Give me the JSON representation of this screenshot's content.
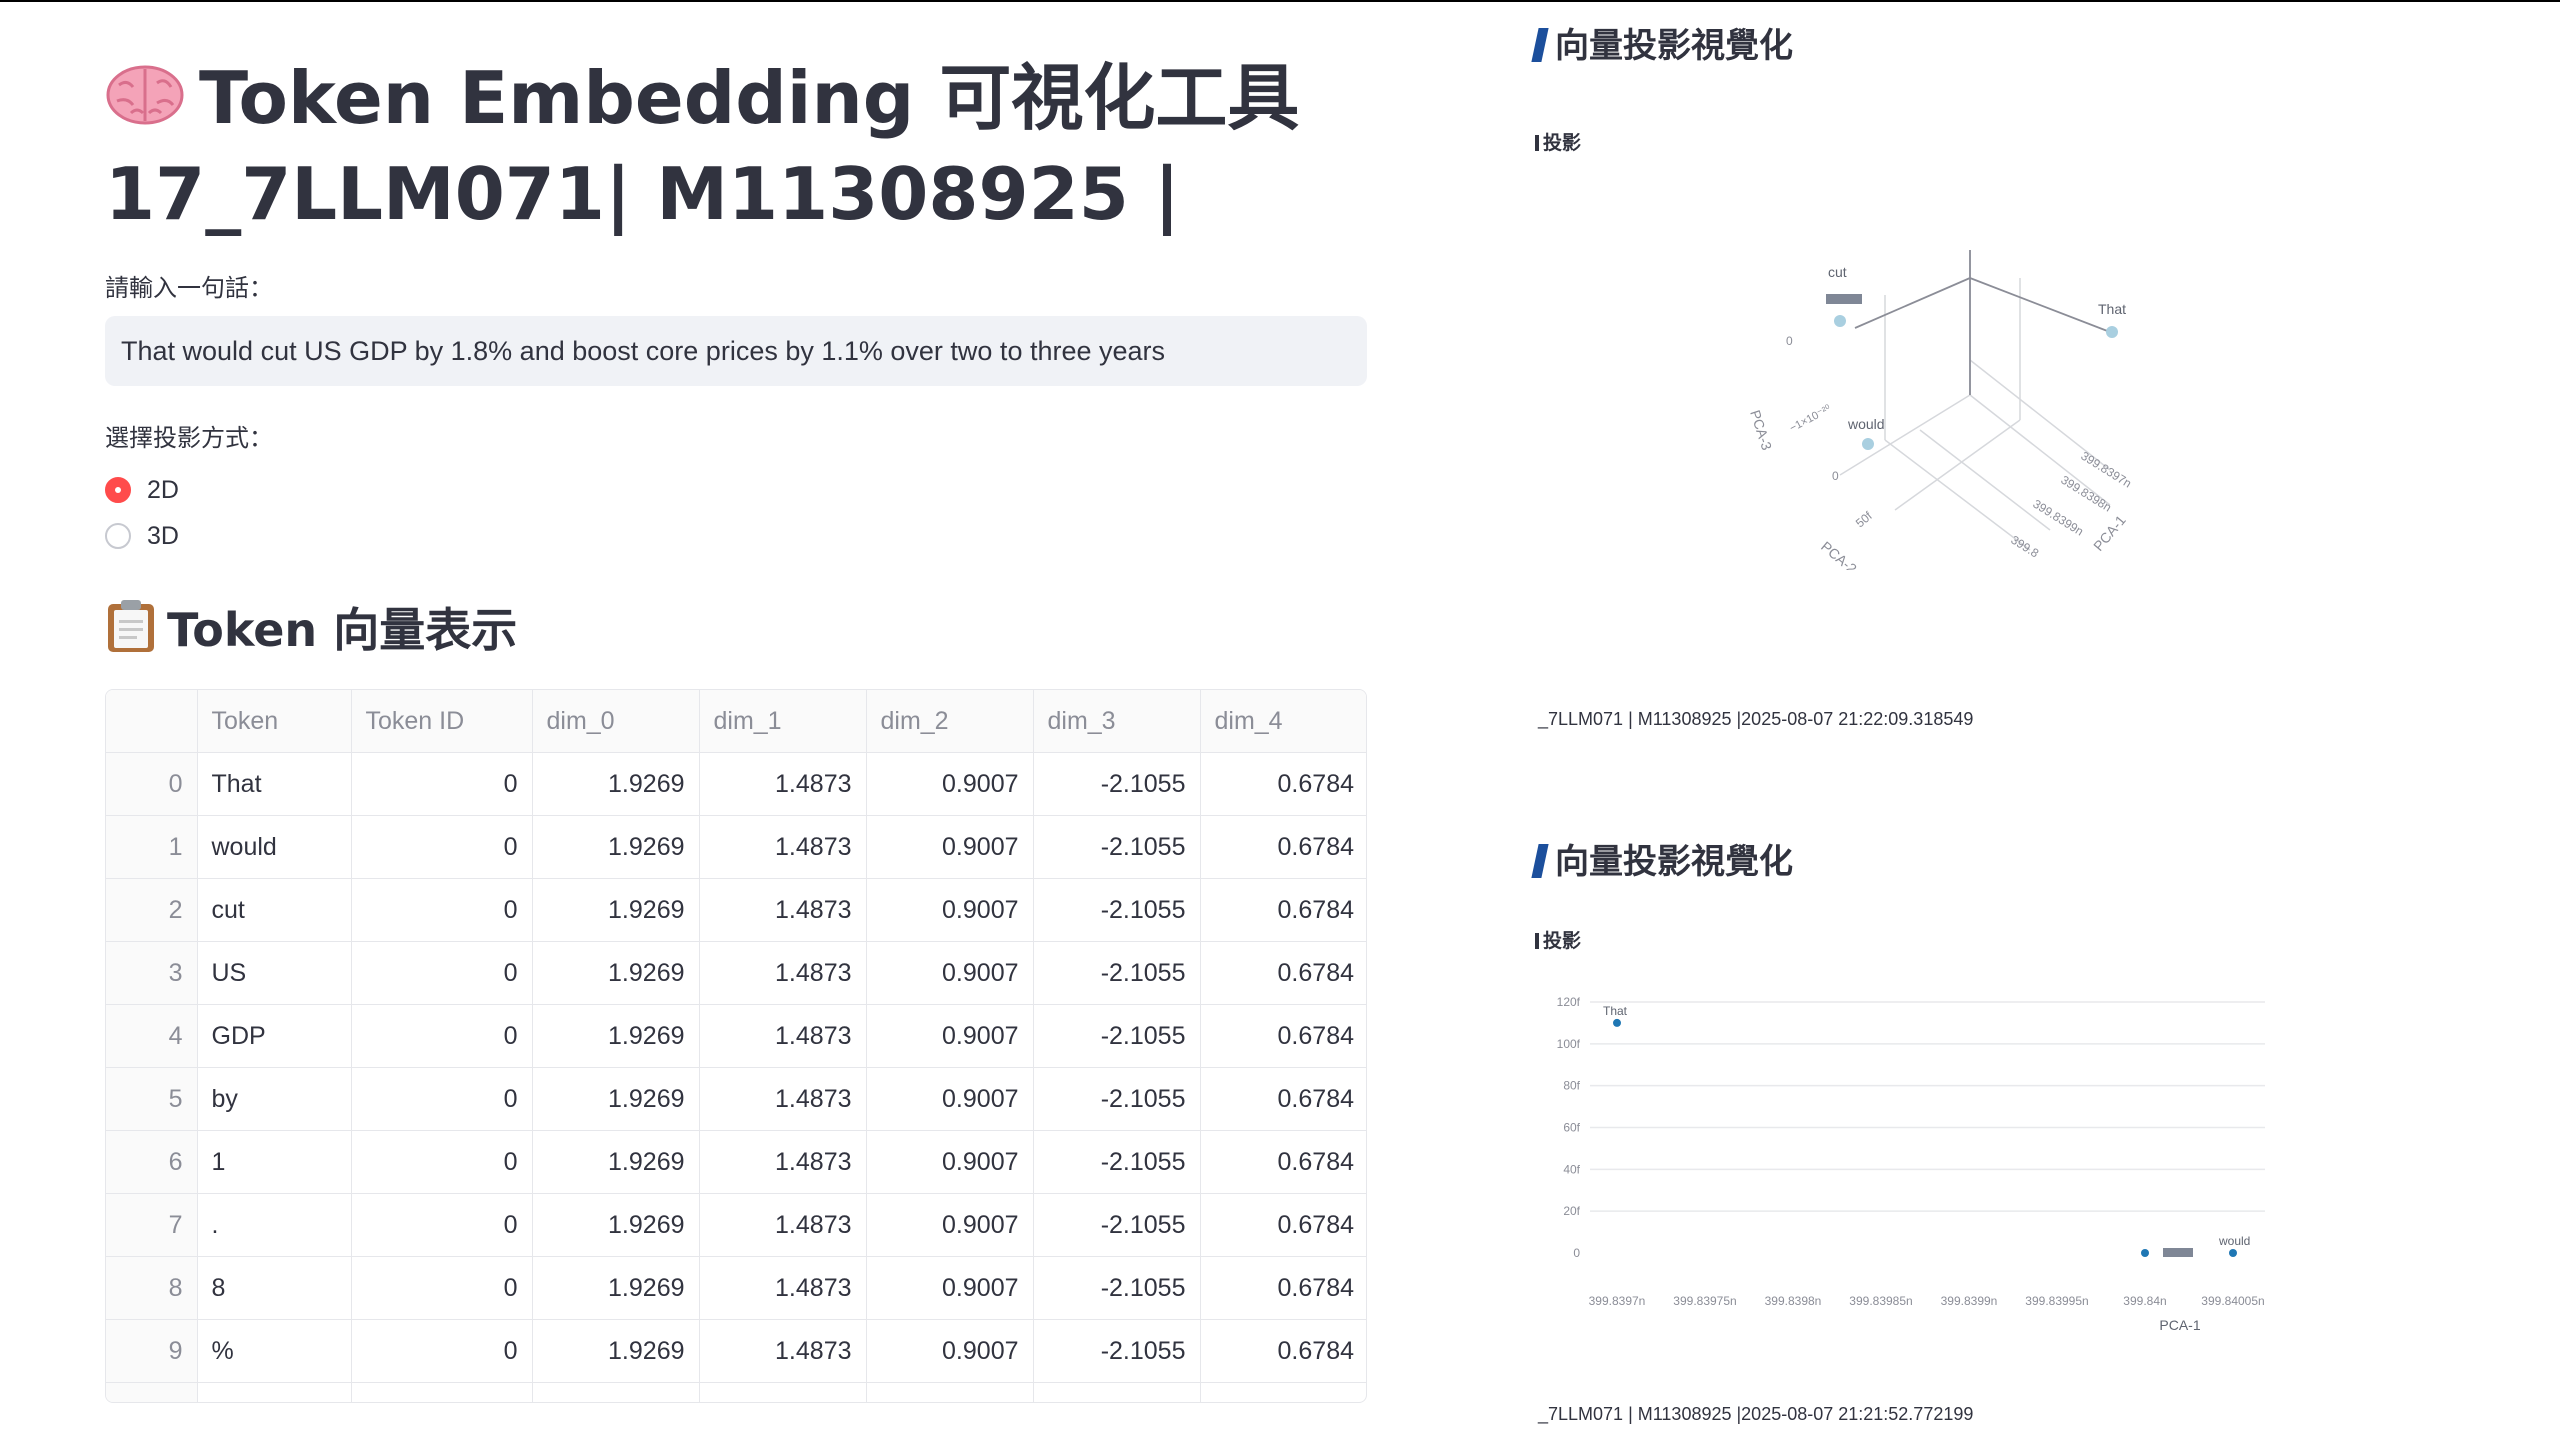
{
  "header": {
    "title_line1": "Token Embedding 可視化工具",
    "title_line2": "17_7LLM071| M11308925 |"
  },
  "input": {
    "label": "請輸入一句話：",
    "value": "That would cut US GDP by 1.8% and boost core prices by 1.1% over two to three years"
  },
  "projection": {
    "label": "選擇投影方式：",
    "options": [
      "2D",
      "3D"
    ],
    "selected": "2D"
  },
  "table_section": {
    "title": "Token 向量表示",
    "columns": [
      "",
      "Token",
      "Token ID",
      "dim_0",
      "dim_1",
      "dim_2",
      "dim_3",
      "dim_4"
    ],
    "rows": [
      [
        "0",
        "That",
        "0",
        "1.9269",
        "1.4873",
        "0.9007",
        "-2.1055",
        "0.6784"
      ],
      [
        "1",
        "would",
        "0",
        "1.9269",
        "1.4873",
        "0.9007",
        "-2.1055",
        "0.6784"
      ],
      [
        "2",
        "cut",
        "0",
        "1.9269",
        "1.4873",
        "0.9007",
        "-2.1055",
        "0.6784"
      ],
      [
        "3",
        "US",
        "0",
        "1.9269",
        "1.4873",
        "0.9007",
        "-2.1055",
        "0.6784"
      ],
      [
        "4",
        "GDP",
        "0",
        "1.9269",
        "1.4873",
        "0.9007",
        "-2.1055",
        "0.6784"
      ],
      [
        "5",
        "by",
        "0",
        "1.9269",
        "1.4873",
        "0.9007",
        "-2.1055",
        "0.6784"
      ],
      [
        "6",
        "1",
        "0",
        "1.9269",
        "1.4873",
        "0.9007",
        "-2.1055",
        "0.6784"
      ],
      [
        "7",
        ".",
        "0",
        "1.9269",
        "1.4873",
        "0.9007",
        "-2.1055",
        "0.6784"
      ],
      [
        "8",
        "8",
        "0",
        "1.9269",
        "1.4873",
        "0.9007",
        "-2.1055",
        "0.6784"
      ],
      [
        "9",
        "%",
        "0",
        "1.9269",
        "1.4873",
        "0.9007",
        "-2.1055",
        "0.6784"
      ]
    ]
  },
  "panel_top": {
    "heading": "向量投影視覺化",
    "subheading": "投影",
    "caption": "_7LLM071 | M11308925 |2025-08-07 21:22:09.318549"
  },
  "panel_bottom": {
    "heading": "向量投影視覺化",
    "subheading": "投影",
    "caption": "_7LLM071 | M11308925 |2025-08-07 21:21:52.772199"
  },
  "chart_data": [
    {
      "type": "scatter",
      "dimensions": 3,
      "axis_labels": [
        "PCA-1",
        "PCA-2",
        "PCA-3"
      ],
      "tick_labels": {
        "pca1": [
          "399.8397n",
          "399.8398n",
          "399.8399n",
          "399.8"
        ],
        "pca2": [
          "0",
          "50f"
        ],
        "pca3": [
          "0",
          "−1×10⁻²⁰"
        ]
      },
      "point_labels": [
        "cut",
        "That",
        "would"
      ],
      "point_color": "#a9cfe0"
    },
    {
      "type": "scatter",
      "dimensions": 2,
      "xlabel": "PCA-1",
      "x_ticks": [
        "399.8397n",
        "399.83975n",
        "399.8398n",
        "399.83985n",
        "399.8399n",
        "399.83995n",
        "399.84n",
        "399.84005n"
      ],
      "y_ticks": [
        "0",
        "20f",
        "40f",
        "60f",
        "80f",
        "100f",
        "120f"
      ],
      "ylim": [
        0,
        120
      ],
      "points": [
        {
          "label": "That",
          "x": 399.8397,
          "y": 110
        },
        {
          "label": "would",
          "x": 399.84005,
          "y": 0
        },
        {
          "label": "",
          "x": 399.84,
          "y": 0
        }
      ],
      "point_color": "#1f77b4"
    }
  ]
}
